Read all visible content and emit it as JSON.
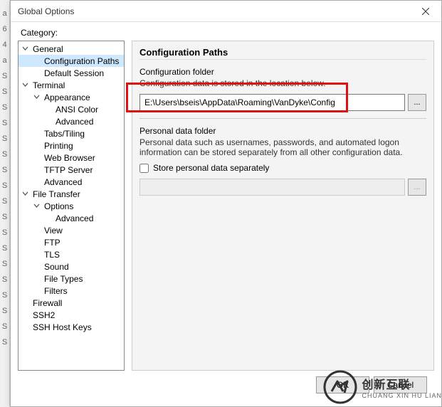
{
  "left_strip": [
    "a",
    "",
    "",
    "",
    "6",
    "4",
    "a",
    "S",
    "S",
    "S",
    "S",
    "S",
    "S",
    "S",
    "S",
    "S",
    "S",
    "S",
    "S",
    "S",
    "S",
    "S",
    "S",
    "S",
    "S"
  ],
  "dialog": {
    "title": "Global Options",
    "category_label": "Category:"
  },
  "tree": [
    {
      "label": "General",
      "level": 0,
      "expanded": true
    },
    {
      "label": "Configuration Paths",
      "level": 1,
      "selected": true
    },
    {
      "label": "Default Session",
      "level": 1
    },
    {
      "label": "Terminal",
      "level": 0,
      "expanded": true
    },
    {
      "label": "Appearance",
      "level": 1,
      "expanded": true
    },
    {
      "label": "ANSI Color",
      "level": 2
    },
    {
      "label": "Advanced",
      "level": 2
    },
    {
      "label": "Tabs/Tiling",
      "level": 1
    },
    {
      "label": "Printing",
      "level": 1
    },
    {
      "label": "Web Browser",
      "level": 1
    },
    {
      "label": "TFTP Server",
      "level": 1
    },
    {
      "label": "Advanced",
      "level": 1
    },
    {
      "label": "File Transfer",
      "level": 0,
      "expanded": true
    },
    {
      "label": "Options",
      "level": 1,
      "expanded": true
    },
    {
      "label": "Advanced",
      "level": 2
    },
    {
      "label": "View",
      "level": 1
    },
    {
      "label": "FTP",
      "level": 1
    },
    {
      "label": "TLS",
      "level": 1
    },
    {
      "label": "Sound",
      "level": 1
    },
    {
      "label": "File Types",
      "level": 1
    },
    {
      "label": "Filters",
      "level": 1
    },
    {
      "label": "Firewall",
      "level": 0
    },
    {
      "label": "SSH2",
      "level": 0
    },
    {
      "label": "SSH Host Keys",
      "level": 0
    }
  ],
  "panel": {
    "title": "Configuration Paths",
    "config_folder_label": "Configuration folder",
    "config_folder_desc": "Configuration data is stored in the location below.",
    "config_path": "E:\\Users\\bseis\\AppData\\Roaming\\VanDyke\\Config",
    "browse": "...",
    "personal_label": "Personal data folder",
    "personal_desc": "Personal data such as usernames, passwords, and automated logon information can be stored separately from all other configuration data.",
    "store_separately": "Store personal data separately"
  },
  "buttons": {
    "ok": "OK",
    "cancel": "Cancel"
  },
  "watermark": {
    "brand": "创新互联",
    "sub": "CHUANG XIN HU LIAN"
  }
}
